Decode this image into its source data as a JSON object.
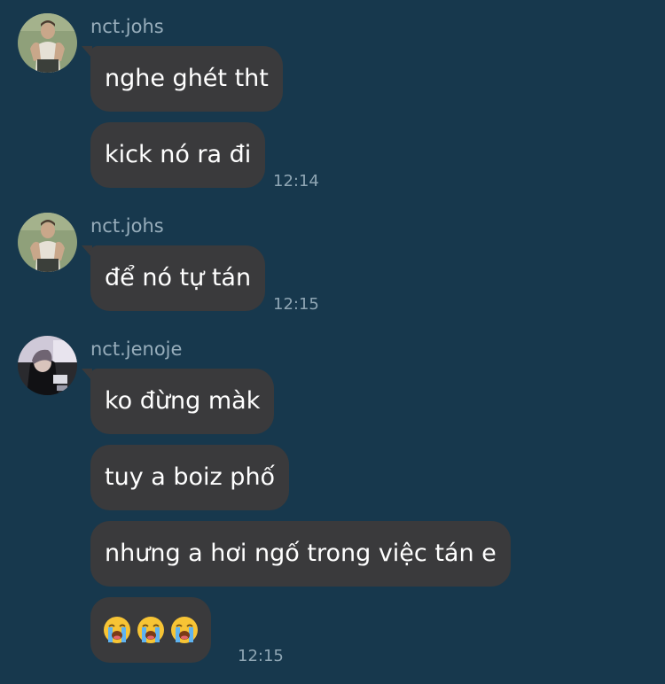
{
  "groups": [
    {
      "sender": "nct.johs",
      "messages": [
        {
          "text": "nghe ghét tht"
        },
        {
          "text": "kick nó ra đi",
          "time": "12:14"
        }
      ]
    },
    {
      "sender": "nct.johs",
      "messages": [
        {
          "text": "để nó tự tán",
          "time": "12:15"
        }
      ]
    },
    {
      "sender": "nct.jenoje",
      "messages": [
        {
          "text": "ko đừng màk"
        },
        {
          "text": "tuy a boiz phố"
        },
        {
          "text": "nhưng a hơi ngố trong việc tán e"
        },
        {
          "emojis": [
            "loudly-crying-face",
            "loudly-crying-face",
            "loudly-crying-face"
          ],
          "time": "12:15"
        }
      ]
    }
  ],
  "icons": {
    "avatar_johs": "avatar-johs",
    "avatar_jenoje": "avatar-jenoje",
    "emoji": "loudly-crying-face"
  },
  "colors": {
    "background": "#17384d",
    "bubble": "#3a3a3c",
    "sender_text": "#97adbb",
    "timestamp": "#8fa6b4"
  }
}
